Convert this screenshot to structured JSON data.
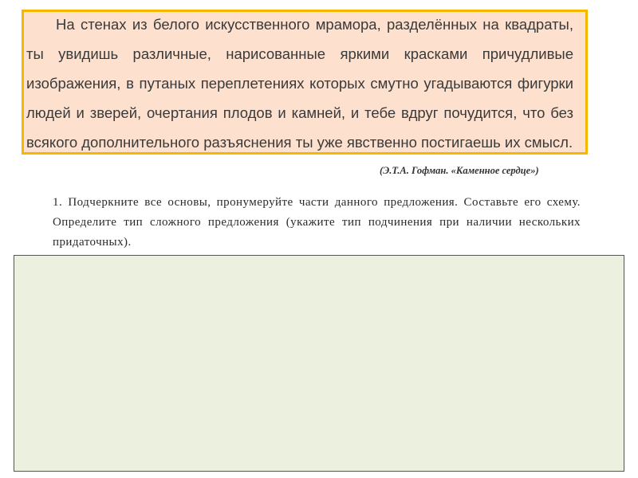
{
  "passage": {
    "text": "На стенах из белого искусственного мрамора, разделённых на квадраты, ты увидишь различные, нарисованные яркими красками причудливые изображения, в путаных переплетениях которых смутно угадываются фигурки людей и зверей, очертания плодов и камней, и тебе вдруг почудится, что без всякого дополнительного разъяснения ты уже явственно постигаешь их смысл."
  },
  "attribution": "(Э.Т.А. Гофман. «Каменное сердце»)",
  "task": {
    "text": "1. Подчеркните все основы, пронумеруйте части данного предложения. Составьте его схему. Определите тип сложного предложения (укажите тип подчинения при наличии нескольких придаточных)."
  },
  "colors": {
    "passage_background": "#fde0cd",
    "passage_border": "#f5b800",
    "answer_area_background": "#ebf1de"
  }
}
